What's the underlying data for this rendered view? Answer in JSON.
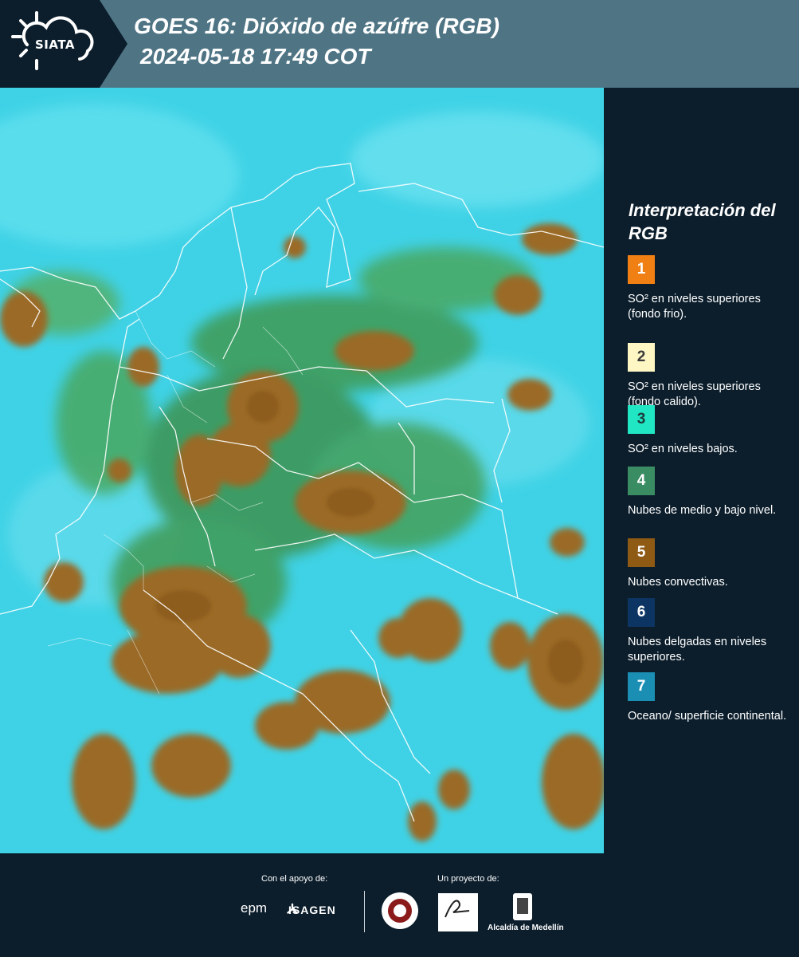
{
  "header": {
    "logo_text": "SIATA",
    "title_line1": "GOES 16: Dióxido de azúfre (RGB)",
    "title_line2": "2024-05-18 17:49 COT"
  },
  "legend": {
    "title": "Interpretación del RGB",
    "items": [
      {
        "number": "1",
        "color": "#f07f14",
        "text_color": "#ffffff",
        "label": "SO² en niveles superiores (fondo frio)."
      },
      {
        "number": "2",
        "color": "#fef6c3",
        "text_color": "#3b3b3b",
        "label": "SO² en niveles superiores (fondo calido)."
      },
      {
        "number": "3",
        "color": "#20e6c4",
        "text_color": "#1d3b3b",
        "label": "SO² en niveles bajos."
      },
      {
        "number": "4",
        "color": "#3a8c62",
        "text_color": "#ffffff",
        "label": "Nubes de medio y bajo nivel."
      },
      {
        "number": "5",
        "color": "#8e5a14",
        "text_color": "#ffffff",
        "label": "Nubes convectivas."
      },
      {
        "number": "6",
        "color": "#0d3563",
        "text_color": "#ffffff",
        "label": "Nubes delgadas en niveles superiores."
      },
      {
        "number": "7",
        "color": "#1b8fb3",
        "text_color": "#ffffff",
        "label": "Oceano/ superficie continental."
      }
    ]
  },
  "footer": {
    "support_caption": "Con el apoyo de:",
    "project_caption": "Un proyecto de:",
    "logos": {
      "epm": "epm",
      "isagen": "ISAGEN",
      "area": "Área Metropolitana Valle de Aburrá",
      "alcaldia": "Alcaldía de Medellín"
    }
  },
  "colors": {
    "background": "#0c1e2c",
    "header_band": "#4f7585",
    "map_sky": "#3fd2e6",
    "convective": "#9a6a28",
    "mid_low_cloud": "#3f9a52"
  }
}
